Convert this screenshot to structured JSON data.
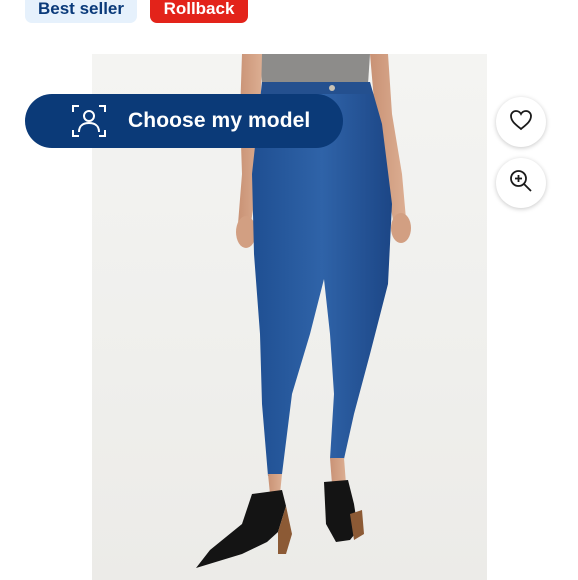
{
  "badges": {
    "best_seller": "Best seller",
    "rollback": "Rollback"
  },
  "product_image": {
    "description_icon": "jeans-model-photo"
  },
  "choose_model": {
    "label": "Choose my model",
    "icon": "person-scan-icon"
  },
  "actions": {
    "favorite_icon": "heart-icon",
    "zoom_icon": "zoom-in-icon"
  },
  "colors": {
    "brand_blue": "#0b3a78",
    "rollback_red": "#e3231a",
    "badge_light_blue": "#e6f1fc"
  }
}
